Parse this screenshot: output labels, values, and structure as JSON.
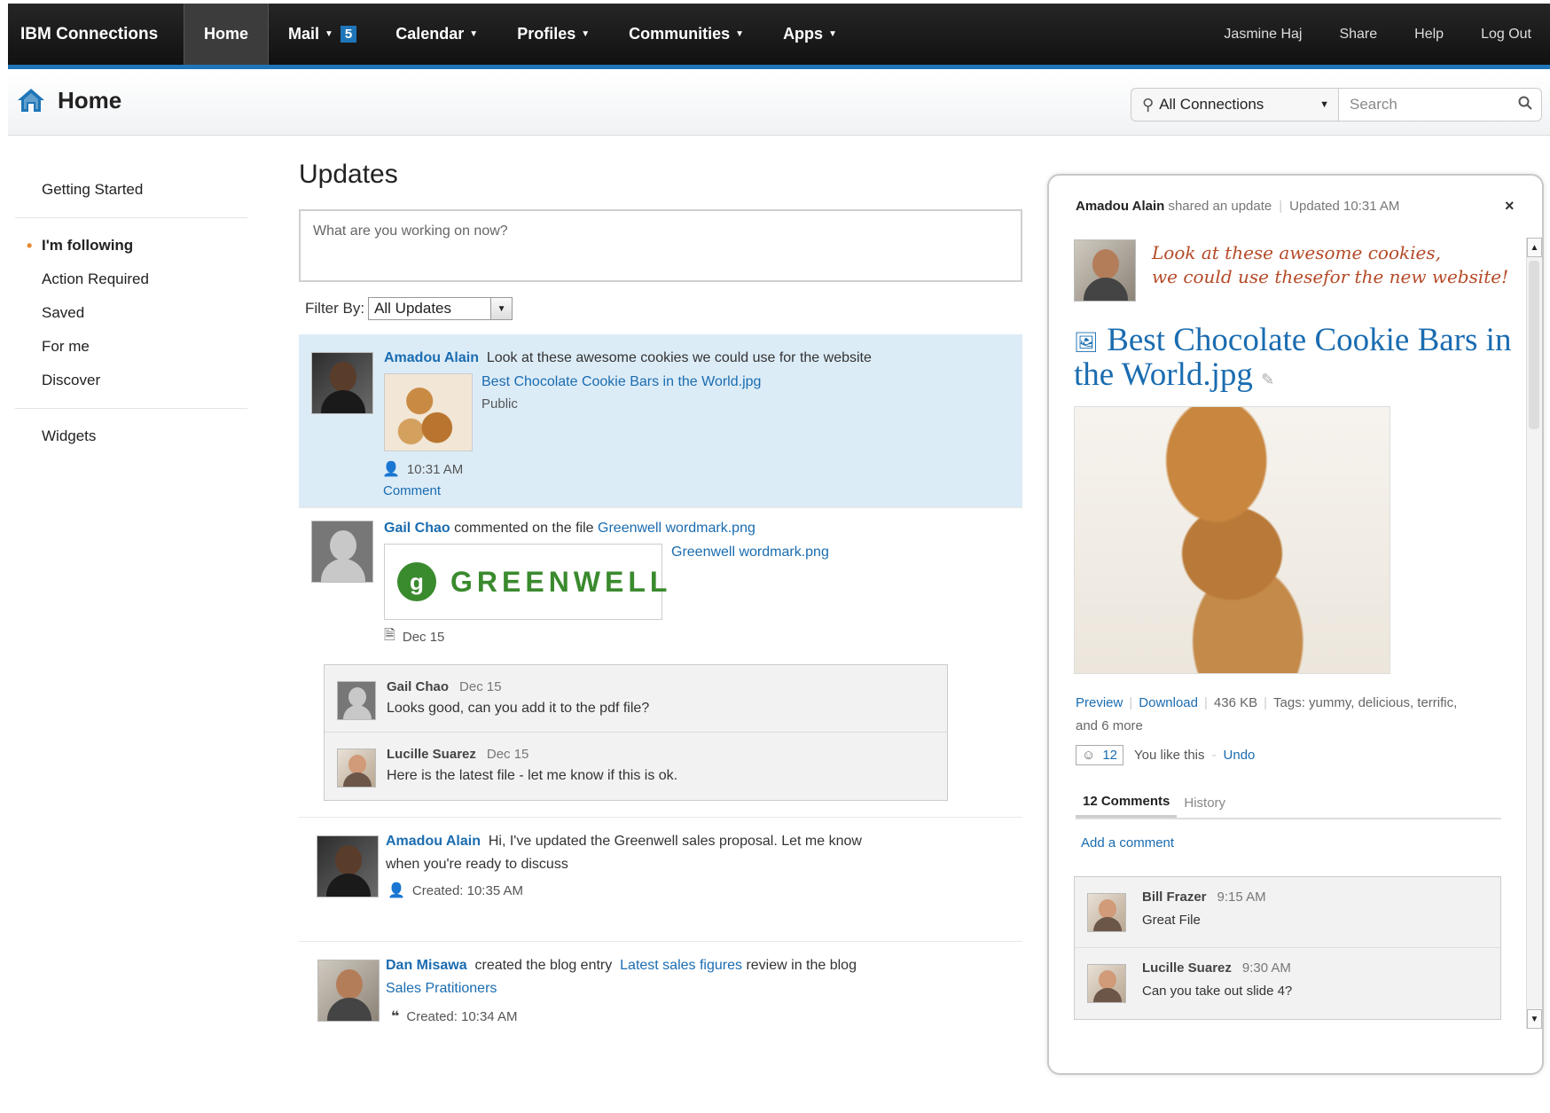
{
  "topnav": {
    "brand": "IBM Connections",
    "tabs": [
      {
        "label": "Home"
      },
      {
        "label": "Mail",
        "badge": "5"
      },
      {
        "label": "Calendar"
      },
      {
        "label": "Profiles"
      },
      {
        "label": "Communities"
      },
      {
        "label": "Apps"
      }
    ],
    "right": [
      "Jasmine Haj",
      "Share",
      "Help",
      "Log Out"
    ]
  },
  "header": {
    "title": "Home",
    "scope": "All Connections",
    "search_placeholder": "Search"
  },
  "sidebar": {
    "items": [
      "Getting Started",
      "I'm following",
      "Action Required",
      "Saved",
      "For me",
      "Discover",
      "Widgets"
    ]
  },
  "main": {
    "title": "Updates",
    "status_placeholder": "What are you working on now?",
    "filter_label": "Filter By:",
    "filter_value": "All Updates",
    "stories": [
      {
        "name": "Amadou Alain",
        "text": "Look at these awesome cookies we could use for the website",
        "file": "Best Chocolate Cookie Bars in the World.jpg",
        "visibility": "Public",
        "time": "10:31 AM",
        "comment_link": "Comment"
      },
      {
        "name": "Gail Chao",
        "text": "commented on the file",
        "file": "Greenwell wordmark.png",
        "file2": "Greenwell wordmark.png",
        "logo_text": "GREENWELL",
        "date": "Dec 15",
        "comments": [
          {
            "name": "Gail Chao",
            "date": "Dec 15",
            "text": "Looks good, can you add it to the pdf file?"
          },
          {
            "name": "Lucille Suarez",
            "date": "Dec 15",
            "text": "Here is the latest file - let me know if this is ok."
          }
        ]
      },
      {
        "name": "Amadou Alain",
        "text": "Hi, I've updated the Greenwell sales proposal.  Let me know",
        "text2": "when you're ready to discuss",
        "created": "Created: 10:35 AM"
      },
      {
        "name": "Dan Misawa",
        "text": "created the blog entry",
        "entry": "Latest sales figures",
        "text2": "review in the blog",
        "blog": "Sales Pratitioners",
        "created": "Created: 10:34 AM"
      }
    ]
  },
  "panel": {
    "author": "Amadou Alain",
    "action": "shared an update",
    "updated": "Updated 10:31 AM",
    "close": "×",
    "quote_line1": "Look at these awesome cookies,",
    "quote_line2": "we could use thesefor the new website!",
    "file_title": "Best Chocolate Cookie Bars in the World.jpg",
    "preview": "Preview",
    "download": "Download",
    "size": "436 KB",
    "tags": "Tags: yummy, delicious, terrific,",
    "tags_more": "and 6 more",
    "likes": "12",
    "you_like": "You like this",
    "undo": "Undo",
    "tab_comments": "12 Comments",
    "tab_history": "History",
    "add_comment": "Add a comment",
    "comments": [
      {
        "name": "Bill Frazer",
        "time": "9:15 AM",
        "text": "Great File"
      },
      {
        "name": "Lucille Suarez",
        "time": "9:30 AM",
        "text": "Can you take out slide 4?"
      }
    ]
  }
}
